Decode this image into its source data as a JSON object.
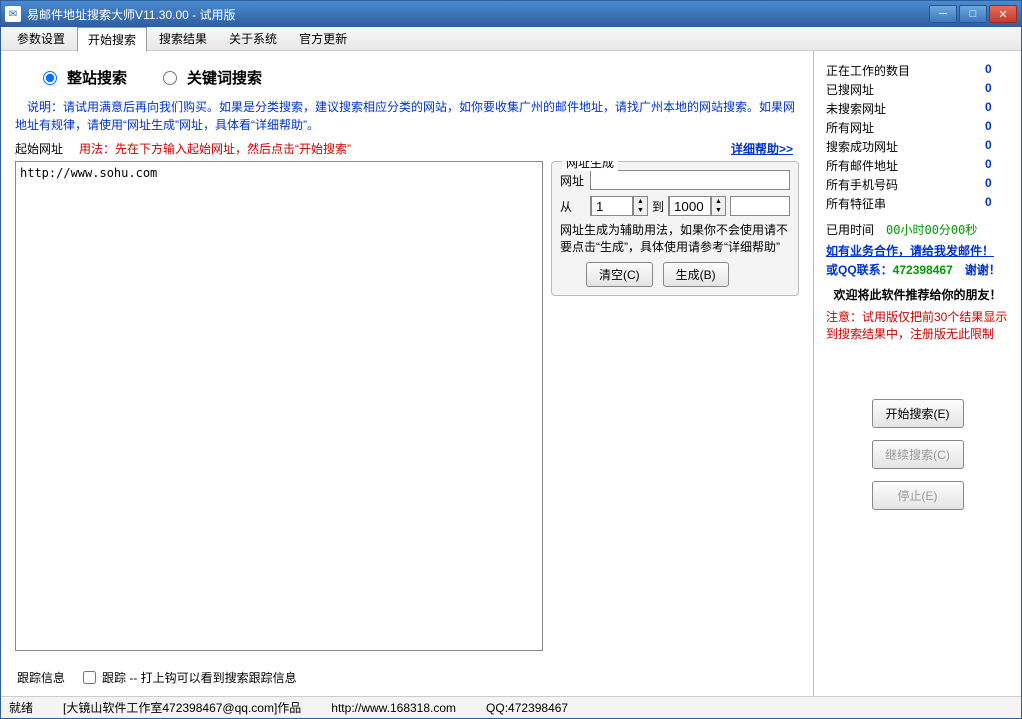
{
  "window": {
    "title": "易邮件地址搜索大师V11.30.00 - 试用版"
  },
  "menu": {
    "items": [
      "参数设置",
      "开始搜索",
      "搜索结果",
      "关于系统",
      "官方更新"
    ],
    "active": 1
  },
  "radios": {
    "full": "整站搜索",
    "keyword": "关键词搜索"
  },
  "description": "　说明：请试用满意后再向我们购买。如果是分类搜索，建议搜索相应分类的网站，如你要收集广州的邮件地址，请找广州本地的网站搜索。如果网地址有规律，请使用“网址生成”网址，具体看“详细帮助”。",
  "usage": {
    "label": "起始网址",
    "red": "用法：先在下方输入起始网址，然后点击“开始搜索”",
    "help": "详细帮助>>"
  },
  "url_text": "http://www.sohu.com",
  "gen": {
    "legend": "网址生成",
    "url_label": "网址",
    "from_label": "从",
    "to_label": "到",
    "from": "1",
    "to": "1000",
    "note": "网址生成为辅助用法，如果你不会使用请不要点击“生成”，具体使用请参考“详细帮助”",
    "clear": "清空(C)",
    "make": "生成(B)"
  },
  "track": {
    "label": "跟踪信息",
    "check": "跟踪 -- 打上钩可以看到搜索跟踪信息"
  },
  "status": {
    "ready": "就绪",
    "credit": "[大镜山软件工作室472398467@qq.com]作品",
    "url": "http://www.168318.com",
    "qq": "QQ:472398467"
  },
  "stats": {
    "rows": [
      {
        "label": "正在工作的数目",
        "val": "0"
      },
      {
        "label": "已搜网址",
        "val": "0"
      },
      {
        "label": "未搜索网址",
        "val": "0"
      },
      {
        "label": "所有网址",
        "val": "0"
      },
      {
        "label": "搜索成功网址",
        "val": "0"
      },
      {
        "label": "所有邮件地址",
        "val": "0"
      },
      {
        "label": "所有手机号码",
        "val": "0"
      },
      {
        "label": "所有特征串",
        "val": "0"
      }
    ]
  },
  "time": {
    "label": "已用时间",
    "value": "00小时00分00秒"
  },
  "cooperate": "如有业务合作，请给我发邮件！",
  "qqline": {
    "prefix": "或QQ联系：",
    "num": "472398467",
    "thanks": "　谢谢！"
  },
  "recommend": "欢迎将此软件推荐给你的朋友！",
  "warning": "注意：试用版仅把前30个结果显示到搜索结果中，注册版无此限制",
  "actions": {
    "start": "开始搜索(E)",
    "cont": "继续搜索(C)",
    "stop": "停止(E)"
  }
}
